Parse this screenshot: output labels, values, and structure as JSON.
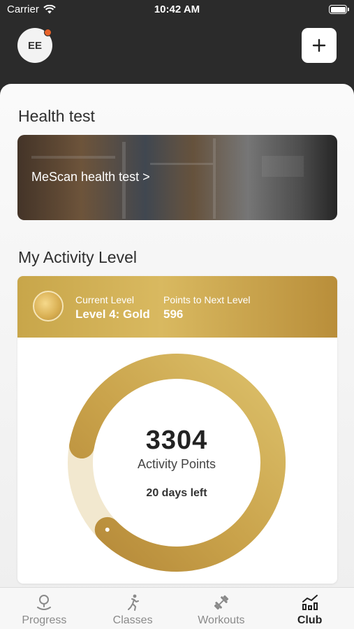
{
  "status_bar": {
    "carrier": "Carrier",
    "time": "10:42 AM"
  },
  "header": {
    "avatar_initials": "EE",
    "notification_color": "#e8632a"
  },
  "health_test": {
    "title": "Health test",
    "card_label": "MeScan health test >"
  },
  "activity": {
    "title": "My Activity Level",
    "current_level_label": "Current Level",
    "current_level_value": "Level 4: Gold",
    "points_next_label": "Points to Next Level",
    "points_next_value": "596",
    "points": "3304",
    "points_label": "Activity Points",
    "days_left": "20 days left",
    "progress_fraction": 0.85,
    "accent_color": "#c9a24a"
  },
  "tabs": [
    {
      "label": "Progress",
      "icon": "location-pin-icon",
      "active": false
    },
    {
      "label": "Classes",
      "icon": "runner-icon",
      "active": false
    },
    {
      "label": "Workouts",
      "icon": "dumbbell-icon",
      "active": false
    },
    {
      "label": "Club",
      "icon": "chart-icon",
      "active": true
    }
  ]
}
